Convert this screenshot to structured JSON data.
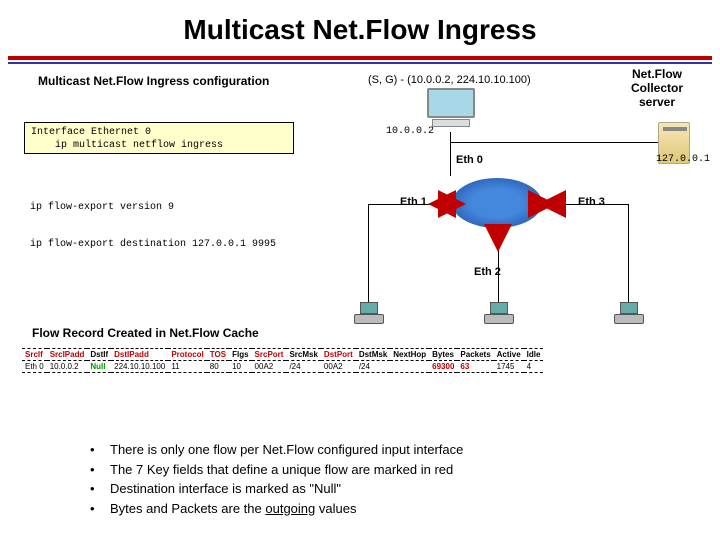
{
  "title": "Multicast Net.Flow Ingress",
  "config_title": "Multicast Net.Flow Ingress configuration",
  "sg_label": "(S, G) - (10.0.0.2, 224.10.10.100)",
  "collector_label": "Net.Flow Collector server",
  "config_box": {
    "line1": "Interface Ethernet 0",
    "line2": "ip multicast netflow ingress"
  },
  "cmd_version": "ip flow-export version 9",
  "cmd_dest": "ip flow-export destination 127.0.0.1 9995",
  "ip_top": "10.0.0.2",
  "ip_right": "127.0.0.1",
  "eth": {
    "e0": "Eth 0",
    "e1": "Eth 1",
    "e2": "Eth 2",
    "e3": "Eth 3"
  },
  "cache_title": "Flow Record Created in Net.Flow Cache",
  "headers": {
    "srcif": "SrcIf",
    "srcip": "SrcIPadd",
    "dstif": "DstIf",
    "dstip": "DstIPadd",
    "proto": "Protocol",
    "tos": "TOS",
    "flgs": "Flgs",
    "srcport": "SrcPort",
    "srcmsk": "SrcMsk",
    "dstport": "DstPort",
    "dstmsk": "DstMsk",
    "nexthop": "NextHop",
    "bytes": "Bytes",
    "pkts": "Packets",
    "active": "Active",
    "idle": "Idle"
  },
  "row": {
    "srcif": "Eth 0",
    "srcip": "10.0.0.2",
    "dstif": "Null",
    "dstip": "224.10.10.100",
    "proto": "11",
    "tos": "80",
    "flgs": "10",
    "srcport": "00A2",
    "srcmsk": "/24",
    "dstport": "00A2",
    "dstmsk": "/24",
    "nexthop": "",
    "bytes": "69300",
    "pkts": "63",
    "active": "1745",
    "idle": "4"
  },
  "bullets": [
    "There is only one flow per Net.Flow configured input interface",
    "The 7 Key fields that define a unique flow are marked in red",
    "Destination interface is marked as \"Null\"",
    [
      "Bytes and Packets are the ",
      "outgoing",
      " values"
    ]
  ],
  "chart_data": {
    "type": "table",
    "title": "Flow Record Created in Net.Flow Cache",
    "columns": [
      "SrcIf",
      "SrcIPadd",
      "DstIf",
      "DstIPadd",
      "Protocol",
      "TOS",
      "Flgs",
      "SrcPort",
      "SrcMsk",
      "DstPort",
      "DstMsk",
      "NextHop",
      "Bytes",
      "Packets",
      "Active",
      "Idle"
    ],
    "rows": [
      [
        "Eth 0",
        "10.0.0.2",
        "Null",
        "224.10.10.100",
        "11",
        "80",
        "10",
        "00A2",
        "/24",
        "00A2",
        "/24",
        "",
        "69300",
        "63",
        "1745",
        "4"
      ]
    ],
    "key_field_columns": [
      "SrcIf",
      "SrcIPadd",
      "DstIPadd",
      "Protocol",
      "TOS",
      "SrcPort",
      "DstPort"
    ],
    "highlighted_cells": {
      "DstIf": "green",
      "Bytes": "red",
      "Packets": "red"
    }
  }
}
